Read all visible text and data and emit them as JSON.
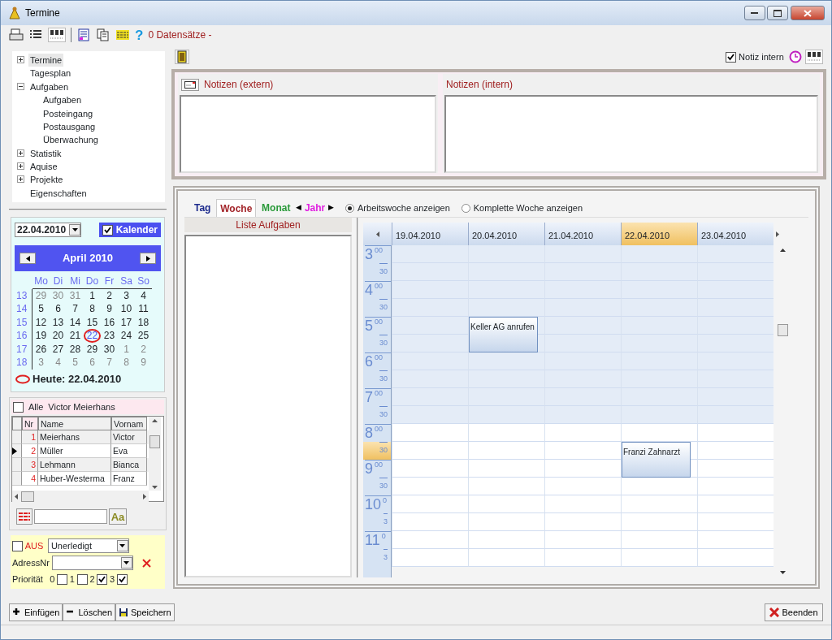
{
  "window": {
    "title": "Termine"
  },
  "toolbar": {
    "help_label": "?",
    "record_count": "0 Datensätze -"
  },
  "tree": [
    {
      "label": "Termine",
      "expanded": false,
      "selected": true
    },
    {
      "label": "Tagesplan",
      "selected": false
    },
    {
      "label": "Aufgaben",
      "expanded": true,
      "selected": false,
      "children": [
        {
          "label": "Aufgaben",
          "selected": false
        },
        {
          "label": "Posteingang",
          "selected": false
        },
        {
          "label": "Postausgang",
          "selected": false
        },
        {
          "label": "Überwachung",
          "selected": false
        }
      ]
    },
    {
      "label": "Statistik",
      "expanded": false,
      "selected": false
    },
    {
      "label": "Aquise",
      "expanded": false,
      "selected": false
    },
    {
      "label": "Projekte",
      "expanded": false,
      "selected": false
    },
    {
      "label": "Eigenschaften",
      "selected": false
    }
  ],
  "date_picker": {
    "value": "22.04.2010",
    "calendar_checked": true,
    "calendar_label": "Kalender"
  },
  "calendar": {
    "month_label": "April 2010",
    "weekdays": [
      "Mo",
      "Di",
      "Mi",
      "Do",
      "Fr",
      "Sa",
      "So"
    ],
    "weeks": [
      {
        "number": "13",
        "days": [
          {
            "day": "29",
            "other_month": true,
            "today": false
          },
          {
            "day": "30",
            "other_month": true,
            "today": false
          },
          {
            "day": "31",
            "other_month": true,
            "today": false
          },
          {
            "day": "1",
            "other_month": false,
            "today": false
          },
          {
            "day": "2",
            "other_month": false,
            "today": false
          },
          {
            "day": "3",
            "other_month": false,
            "today": false
          },
          {
            "day": "4",
            "other_month": false,
            "today": false
          }
        ]
      },
      {
        "number": "14",
        "days": [
          {
            "day": "5",
            "other_month": false,
            "today": false
          },
          {
            "day": "6",
            "other_month": false,
            "today": false
          },
          {
            "day": "7",
            "other_month": false,
            "today": false
          },
          {
            "day": "8",
            "other_month": false,
            "today": false
          },
          {
            "day": "9",
            "other_month": false,
            "today": false
          },
          {
            "day": "10",
            "other_month": false,
            "today": false
          },
          {
            "day": "11",
            "other_month": false,
            "today": false
          }
        ]
      },
      {
        "number": "15",
        "days": [
          {
            "day": "12",
            "other_month": false,
            "today": false
          },
          {
            "day": "13",
            "other_month": false,
            "today": false
          },
          {
            "day": "14",
            "other_month": false,
            "today": false
          },
          {
            "day": "15",
            "other_month": false,
            "today": false
          },
          {
            "day": "16",
            "other_month": false,
            "today": false
          },
          {
            "day": "17",
            "other_month": false,
            "today": false
          },
          {
            "day": "18",
            "other_month": false,
            "today": false
          }
        ]
      },
      {
        "number": "16",
        "days": [
          {
            "day": "19",
            "other_month": false,
            "today": false
          },
          {
            "day": "20",
            "other_month": false,
            "today": false
          },
          {
            "day": "21",
            "other_month": false,
            "today": false
          },
          {
            "day": "22",
            "other_month": false,
            "today": true
          },
          {
            "day": "23",
            "other_month": false,
            "today": false
          },
          {
            "day": "24",
            "other_month": false,
            "today": false
          },
          {
            "day": "25",
            "other_month": false,
            "today": false
          }
        ]
      },
      {
        "number": "17",
        "days": [
          {
            "day": "26",
            "other_month": false,
            "today": false
          },
          {
            "day": "27",
            "other_month": false,
            "today": false
          },
          {
            "day": "28",
            "other_month": false,
            "today": false
          },
          {
            "day": "29",
            "other_month": false,
            "today": false
          },
          {
            "day": "30",
            "other_month": false,
            "today": false
          },
          {
            "day": "1",
            "other_month": true,
            "today": false
          },
          {
            "day": "2",
            "other_month": true,
            "today": false
          }
        ]
      },
      {
        "number": "18",
        "days": [
          {
            "day": "3",
            "other_month": true,
            "today": false
          },
          {
            "day": "4",
            "other_month": true,
            "today": false
          },
          {
            "day": "5",
            "other_month": true,
            "today": false
          },
          {
            "day": "6",
            "other_month": true,
            "today": false
          },
          {
            "day": "7",
            "other_month": true,
            "today": false
          },
          {
            "day": "8",
            "other_month": true,
            "today": false
          },
          {
            "day": "9",
            "other_month": true,
            "today": false
          }
        ]
      }
    ],
    "today_label": "Heute: 22.04.2010"
  },
  "people": {
    "all_checked": false,
    "all_label": "Alle",
    "current_name": "Victor  Meierhans",
    "columns": [
      "Nr",
      "Name",
      "Vornam"
    ],
    "rows": [
      {
        "nr": "1",
        "name": "Meierhans",
        "first_name": "Victor",
        "selected": false
      },
      {
        "nr": "2",
        "name": "Müller",
        "first_name": "Eva",
        "selected": true
      },
      {
        "nr": "3",
        "name": "Lehmann",
        "first_name": "Bianca",
        "selected": false
      },
      {
        "nr": "4",
        "name": "Huber-Westerma",
        "first_name": "Franz",
        "selected": false
      }
    ]
  },
  "search": {
    "button_label": "Aa"
  },
  "filter": {
    "off_checked": false,
    "off_label": "AUS",
    "status_value": "Unerledigt",
    "address_label": "AdressNr",
    "priority_label": "Priorität",
    "priorities": [
      {
        "label": "0",
        "checked": false
      },
      {
        "label": "1",
        "checked": false
      },
      {
        "label": "2",
        "checked": true
      },
      {
        "label": "3",
        "checked": true
      }
    ]
  },
  "actions": [
    {
      "label": "Einfügen",
      "kind": "add"
    },
    {
      "label": "Löschen",
      "kind": "delete"
    },
    {
      "label": "Speichern",
      "kind": "save"
    }
  ],
  "close_button": {
    "label": "Beenden"
  },
  "notes": {
    "internal_checked": true,
    "internal_label": "Notiz intern",
    "panes": [
      {
        "title": "Notizen (extern)",
        "kind": "with_button"
      },
      {
        "title": "Notizen (intern)",
        "kind": "plain"
      }
    ]
  },
  "views": [
    {
      "label": "Tag",
      "kind": "tab",
      "color": "#1c2a8c",
      "selected": false
    },
    {
      "label": "Woche",
      "kind": "tab",
      "color": "#a3252a",
      "selected": true
    },
    {
      "label": "Monat",
      "kind": "tab",
      "color": "#2a9a3a",
      "selected": false
    },
    {
      "label": "Jahr",
      "kind": "stepper",
      "prev": "◀",
      "next": "▶",
      "color": "#e020e0",
      "selected": false
    }
  ],
  "week_options": [
    {
      "label": "Arbeitswoche anzeigen",
      "selected": true
    },
    {
      "label": "Komplette Woche anzeigen",
      "selected": false
    }
  ],
  "task_list": {
    "title": "Liste Aufgaben"
  },
  "schedule": {
    "days": [
      {
        "label": "19.04.2010",
        "selected": false
      },
      {
        "label": "20.04.2010",
        "selected": false
      },
      {
        "label": "21.04.2010",
        "selected": false
      },
      {
        "label": "22.04.2010",
        "selected": true
      },
      {
        "label": "23.04.2010",
        "selected": false
      }
    ],
    "hours": [
      {
        "hour": "3",
        "minutes": "00",
        "half": "30",
        "off_hours": true,
        "half_current": false
      },
      {
        "hour": "4",
        "minutes": "00",
        "half": "30",
        "off_hours": true,
        "half_current": false
      },
      {
        "hour": "5",
        "minutes": "00",
        "half": "30",
        "off_hours": true,
        "half_current": false,
        "cells": [
          {
            "kind": "free"
          },
          {
            "kind": "appointment_on_the_hour",
            "title": "Keller AG anrufen"
          },
          {
            "kind": "free"
          },
          {
            "kind": "free"
          },
          {
            "kind": "free"
          }
        ]
      },
      {
        "hour": "6",
        "minutes": "00",
        "half": "30",
        "off_hours": true,
        "half_current": false
      },
      {
        "hour": "7",
        "minutes": "00",
        "half": "30",
        "off_hours": true,
        "half_current": false
      },
      {
        "hour": "8",
        "minutes": "00",
        "half": "30",
        "off_hours": false,
        "half_current": true,
        "cells": [
          {
            "kind": "free"
          },
          {
            "kind": "free"
          },
          {
            "kind": "free"
          },
          {
            "kind": "appointment_on_the_half_hour",
            "title": "Franzi Zahnarzt"
          },
          {
            "kind": "free"
          }
        ]
      },
      {
        "hour": "9",
        "minutes": "00",
        "half": "30",
        "off_hours": false,
        "half_current": false
      },
      {
        "hour": "10",
        "minutes": "0",
        "half": "3",
        "off_hours": false,
        "half_current": false
      },
      {
        "hour": "11",
        "minutes": "0",
        "half": "3",
        "off_hours": false,
        "half_current": false
      }
    ]
  }
}
